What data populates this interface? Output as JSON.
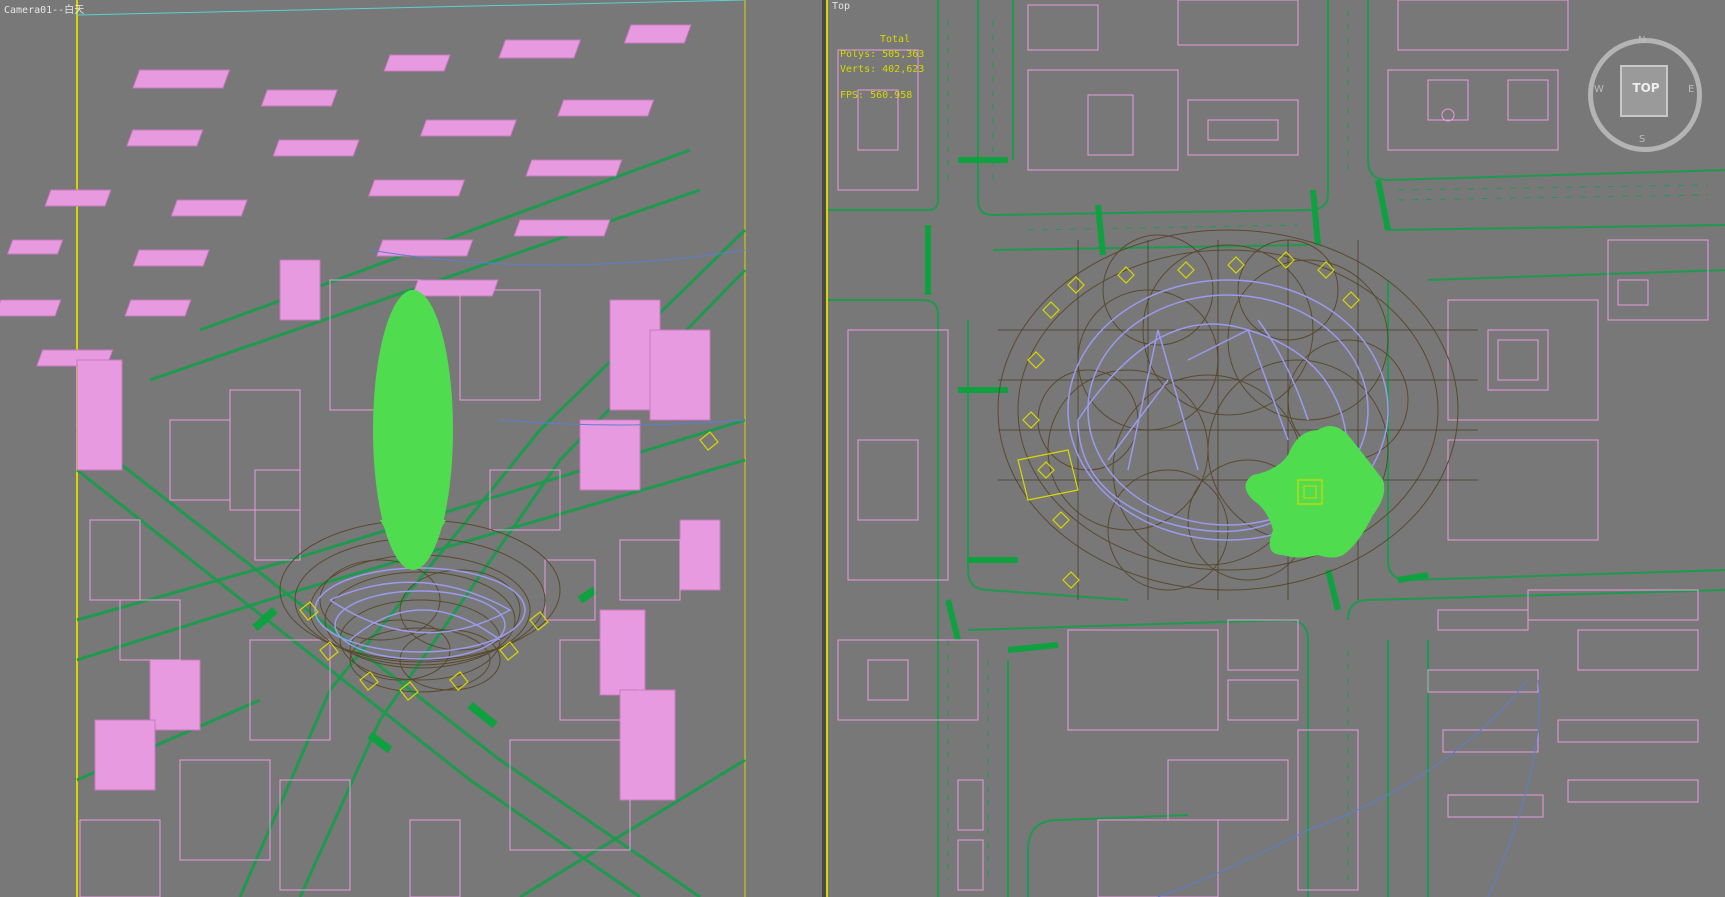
{
  "viewports": {
    "left": {
      "label": "Camera01--白天"
    },
    "right": {
      "label": "Top",
      "stats": {
        "total_label": "Total",
        "polys": "Polys: 505,363",
        "verts": "Verts: 402,623",
        "fps": "FPS:   560.958"
      },
      "viewcube": {
        "face": "TOP",
        "north": "N",
        "west": "W",
        "east": "E",
        "south": "S"
      }
    }
  },
  "colors": {
    "background": "#787878",
    "buildings": "#e89ae0",
    "roads": "#1e9a4e",
    "selection": "#d7d700",
    "fountain": "#4fdd4f",
    "trees": "#5a4a2e",
    "water_lines": "#9a9aee"
  }
}
